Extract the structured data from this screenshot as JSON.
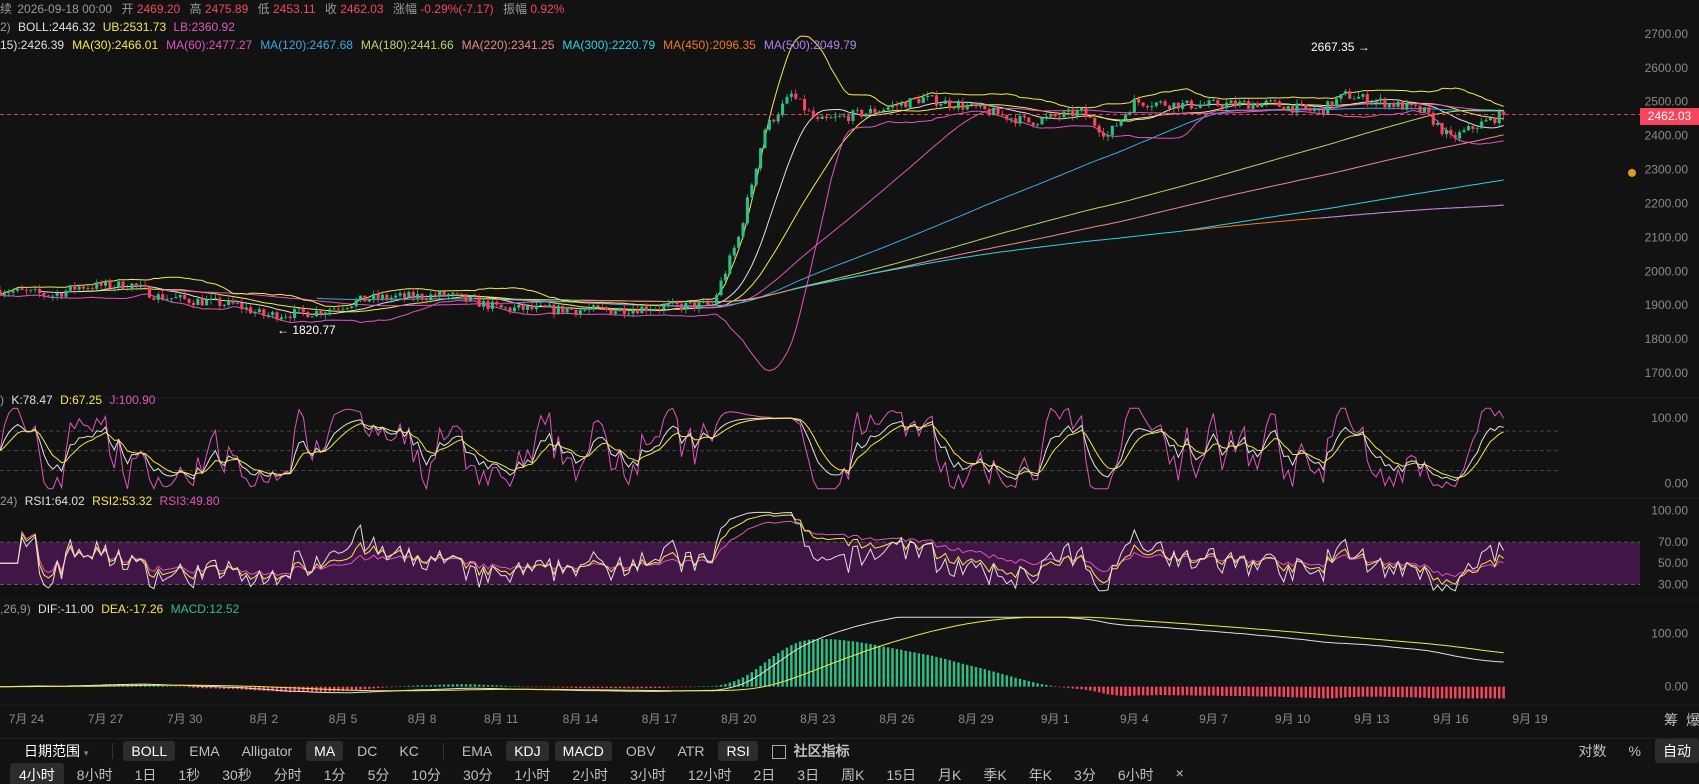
{
  "header": {
    "prefix": "续",
    "date": "2026-09-18 00:00",
    "open_label": "开",
    "open": "2469.20",
    "high_label": "高",
    "high": "2475.89",
    "low_label": "低",
    "low": "2453.11",
    "close_label": "收",
    "close": "2462.03",
    "change_label": "涨幅",
    "change": "-0.29%(-7.17)",
    "amp_label": "振幅",
    "amp": "0.92%"
  },
  "boll_legend": {
    "prefix": "2)",
    "boll": "BOLL:2446.32",
    "ub": "UB:2531.73",
    "lb": "LB:2360.92"
  },
  "ma_legend": [
    {
      "text": "15):2426.39",
      "color": "#e0e0e0"
    },
    {
      "text": "MA(30):2466.01",
      "color": "#f5e84a"
    },
    {
      "text": "MA(60):2477.27",
      "color": "#e055c0"
    },
    {
      "text": "MA(120):2467.68",
      "color": "#3fa7e0"
    },
    {
      "text": "MA(180):2441.66",
      "color": "#b8d86a"
    },
    {
      "text": "MA(220):2341.25",
      "color": "#e88a8a"
    },
    {
      "text": "MA(300):2220.79",
      "color": "#30d0e0"
    },
    {
      "text": "MA(450):2096.35",
      "color": "#f07820"
    },
    {
      "text": "MA(500):2049.79",
      "color": "#b080f0"
    }
  ],
  "kdj_legend": {
    "prefix": ")",
    "k": "K:78.47",
    "d": "D:67.25",
    "j": "J:100.90"
  },
  "rsi_legend": {
    "prefix": "24)",
    "r1": "RSI1:64.02",
    "r2": "RSI2:53.32",
    "r3": "RSI3:49.80"
  },
  "macd_legend": {
    "prefix": ",26,9)",
    "dif": "DIF:-11.00",
    "dea": "DEA:-17.26",
    "macd": "MACD:12.52"
  },
  "annotations": {
    "high": "2667.35 →",
    "low": "← 1820.77"
  },
  "last_price": "2462.03",
  "colors": {
    "up": "#2ebd85",
    "down": "#f6465d",
    "bg": "#121212"
  },
  "chart_data": [
    {
      "type": "candlestick",
      "name": "price",
      "yticks": [
        1700,
        1800,
        1900,
        2000,
        2100,
        2200,
        2300,
        2400,
        2500,
        2600,
        2700
      ],
      "ytick_labels": [
        "1700.00",
        "1800.00",
        "1900.00",
        "2000.00",
        "2100.00",
        "2200.00",
        "2300.00",
        "2400.00",
        "2500.00",
        "2600.00",
        "2700.00"
      ],
      "ylim": [
        1650,
        2735
      ],
      "xlim": [
        "2026-07-23",
        "2026-09-19"
      ],
      "xticks": [
        "2026-07-24",
        "2026-07-27",
        "2026-07-30",
        "2026-08-02",
        "2026-08-05",
        "2026-08-08",
        "2026-08-11",
        "2026-08-14",
        "2026-08-17",
        "2026-08-20",
        "2026-08-23",
        "2026-08-26",
        "2026-08-29",
        "2026-09-01",
        "2026-09-04",
        "2026-09-07",
        "2026-09-10",
        "2026-09-13",
        "2026-09-16",
        "2026-09-19"
      ],
      "xtick_labels": [
        "7月 24",
        "7月 27",
        "7月 30",
        "8月 2",
        "8月 5",
        "8月 8",
        "8月 11",
        "8月 14",
        "8月 17",
        "8月 20",
        "8月 23",
        "8月 26",
        "8月 29",
        "9月 1",
        "9月 4",
        "9月 7",
        "9月 10",
        "9月 13",
        "9月 16",
        "9月 19"
      ],
      "close_path": [
        [
          "2026-07-23",
          1945
        ],
        [
          "2026-07-25",
          1930
        ],
        [
          "2026-07-26",
          1955
        ],
        [
          "2026-07-28",
          1960
        ],
        [
          "2026-07-29",
          1925
        ],
        [
          "2026-08-01",
          1900
        ],
        [
          "2026-08-02",
          1870
        ],
        [
          "2026-08-04",
          1880
        ],
        [
          "2026-08-06",
          1920
        ],
        [
          "2026-08-09",
          1930
        ],
        [
          "2026-08-11",
          1890
        ],
        [
          "2026-08-15",
          1885
        ],
        [
          "2026-08-17",
          1895
        ],
        [
          "2026-08-19",
          1900
        ],
        [
          "2026-08-20",
          2100
        ],
        [
          "2026-08-21",
          2420
        ],
        [
          "2026-08-22",
          2520
        ],
        [
          "2026-08-23",
          2440
        ],
        [
          "2026-08-25",
          2470
        ],
        [
          "2026-08-27",
          2510
        ],
        [
          "2026-08-29",
          2480
        ],
        [
          "2026-08-31",
          2440
        ],
        [
          "2026-09-02",
          2470
        ],
        [
          "2026-09-03",
          2400
        ],
        [
          "2026-09-04",
          2500
        ],
        [
          "2026-09-06",
          2490
        ],
        [
          "2026-09-09",
          2495
        ],
        [
          "2026-09-11",
          2470
        ],
        [
          "2026-09-12",
          2520
        ],
        [
          "2026-09-14",
          2490
        ],
        [
          "2026-09-15",
          2470
        ],
        [
          "2026-09-16",
          2390
        ],
        [
          "2026-09-17",
          2430
        ],
        [
          "2026-09-18",
          2462
        ]
      ],
      "high_marker": {
        "date": "2026-09-12",
        "value": 2667.35
      },
      "low_marker": {
        "date": "2026-08-02",
        "value": 1820.77
      },
      "last_price": 2462.03,
      "ma_end_values": [
        2426.39,
        2466.01,
        2477.27,
        2467.68,
        2441.66,
        2341.25,
        2220.79,
        2096.35,
        2049.79
      ],
      "boll": {
        "mid": 2446.32,
        "ub": 2531.73,
        "lb": 2360.92
      }
    },
    {
      "type": "line",
      "name": "KDJ",
      "yticks": [
        0,
        100
      ],
      "ytick_labels": [
        "0.00",
        "100.00"
      ],
      "ylim": [
        -10,
        120
      ],
      "series": [
        {
          "name": "K",
          "last": 78.47
        },
        {
          "name": "D",
          "last": 67.25
        },
        {
          "name": "J",
          "last": 100.9
        }
      ]
    },
    {
      "type": "line",
      "name": "RSI",
      "yticks": [
        30,
        50,
        70,
        100
      ],
      "ytick_labels": [
        "30.00",
        "50.00",
        "70.00",
        "100.00"
      ],
      "ylim": [
        20,
        105
      ],
      "band": [
        30,
        70
      ],
      "series": [
        {
          "name": "RSI1",
          "last": 64.02
        },
        {
          "name": "RSI2",
          "last": 53.32
        },
        {
          "name": "RSI3",
          "last": 49.8
        }
      ]
    },
    {
      "type": "bar",
      "name": "MACD",
      "yticks": [
        0,
        100
      ],
      "ytick_labels": [
        "0.00",
        "100.00"
      ],
      "ylim": [
        -25,
        140
      ],
      "dif": -11.0,
      "dea": -17.26,
      "macd": 12.52
    }
  ],
  "toolbar": {
    "range": "日期范围",
    "items": [
      {
        "label": "BOLL",
        "on": true
      },
      {
        "label": "EMA",
        "on": false
      },
      {
        "label": "Alligator",
        "on": false
      },
      {
        "label": "MA",
        "on": true
      },
      {
        "label": "DC",
        "on": false
      },
      {
        "label": "KC",
        "on": false
      }
    ],
    "sub_items": [
      {
        "label": "EMA",
        "on": false
      },
      {
        "label": "KDJ",
        "on": true
      },
      {
        "label": "MACD",
        "on": true
      },
      {
        "label": "OBV",
        "on": false
      },
      {
        "label": "ATR",
        "on": false
      },
      {
        "label": "RSI",
        "on": true
      }
    ],
    "community": "社区指标",
    "log": "对数",
    "pct": "%",
    "auto": "自动"
  },
  "timeframes": [
    {
      "label": "4小时",
      "on": true
    },
    {
      "label": "8小时"
    },
    {
      "label": "1日"
    },
    {
      "label": "1秒"
    },
    {
      "label": "30秒"
    },
    {
      "label": "分时"
    },
    {
      "label": "1分"
    },
    {
      "label": "5分"
    },
    {
      "label": "10分"
    },
    {
      "label": "30分"
    },
    {
      "label": "1小时"
    },
    {
      "label": "2小时"
    },
    {
      "label": "3小时"
    },
    {
      "label": "12小时"
    },
    {
      "label": "2日"
    },
    {
      "label": "3日"
    },
    {
      "label": "周K"
    },
    {
      "label": "15日"
    },
    {
      "label": "月K"
    },
    {
      "label": "季K"
    },
    {
      "label": "年K"
    },
    {
      "label": "3分"
    },
    {
      "label": "6小时"
    },
    {
      "label": "×"
    }
  ],
  "side_text": {
    "a": "筹",
    "b": "爆"
  }
}
